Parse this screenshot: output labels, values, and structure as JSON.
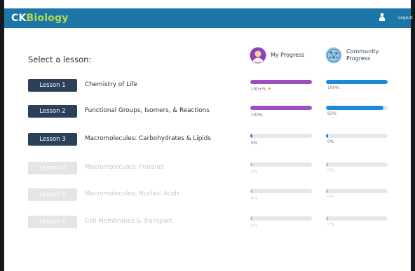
{
  "app": {
    "brand_ck": "CK",
    "brand_bio": "Biology",
    "logout_label": "Logout",
    "user_icon": "user-icon"
  },
  "page": {
    "title": "Select a lesson:"
  },
  "columns": {
    "my_progress": {
      "label": "My Progress",
      "icon": "student-avatar-icon"
    },
    "community_progress": {
      "label_line1": "Community",
      "label_line2": "Progress",
      "icon": "globe-network-icon"
    }
  },
  "colors": {
    "header": "#1c76a8",
    "brand_accent": "#b6dc48",
    "button": "#2b4058",
    "my_fill": "#9b4fc0",
    "community_fill": "#1d8ad9",
    "track": "#e4e8ec",
    "locked_button": "#e3e5e7"
  },
  "lessons": [
    {
      "button": "Lesson 1",
      "name": "Chemistry of Life",
      "my_value": 1.0,
      "my_label": "100+%",
      "my_star": "★",
      "comm_value": 1.0,
      "comm_label": "100%",
      "locked": false
    },
    {
      "button": "Lesson 2",
      "name": "Functional Groups, Isomers, & Reactions",
      "my_value": 1.0,
      "my_label": "100%",
      "my_star": "",
      "comm_value": 0.93,
      "comm_label": "93%",
      "locked": false
    },
    {
      "button": "Lesson 3",
      "name": "Macromolecules: Carbohydrates & Lipids",
      "my_value": 0.0,
      "my_label": "0%",
      "my_star": "",
      "comm_value": 0.0,
      "comm_label": "0%",
      "locked": false
    },
    {
      "button": "Lesson 4",
      "name": "Macromolecules: Proteins",
      "my_value": 0.0,
      "my_label": "0%",
      "my_star": "",
      "comm_value": 0.0,
      "comm_label": "0%",
      "locked": true
    },
    {
      "button": "Lesson 5",
      "name": "Macromolecules: Nucleic Acids",
      "my_value": 0.0,
      "my_label": "0%",
      "my_star": "",
      "comm_value": 0.0,
      "comm_label": "0%",
      "locked": true
    },
    {
      "button": "Lesson 6",
      "name": "Cell Membranes & Transport",
      "my_value": 0.0,
      "my_label": "0%",
      "my_star": "",
      "comm_value": 0.0,
      "comm_label": "0%",
      "locked": true
    }
  ]
}
